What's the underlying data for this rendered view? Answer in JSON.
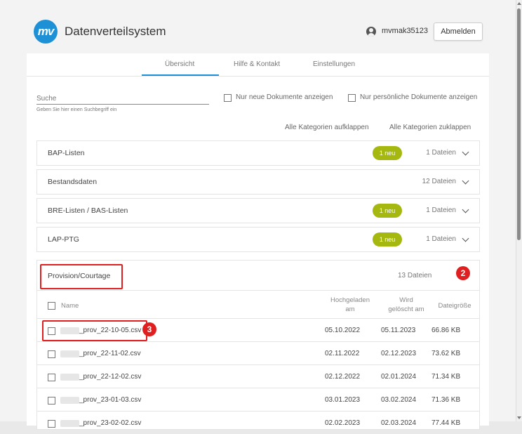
{
  "app": {
    "logo_text": "mv",
    "title": "Datenverteilsystem"
  },
  "user": {
    "name": "mvmak35123",
    "logout_label": "Abmelden"
  },
  "tabs": [
    {
      "label": "Übersicht",
      "active": true
    },
    {
      "label": "Hilfe & Kontakt",
      "active": false
    },
    {
      "label": "Einstellungen",
      "active": false
    }
  ],
  "search": {
    "placeholder": "Suche",
    "hint": "Geben Sie hier einen Suchbegriff ein"
  },
  "filters": {
    "new_only_label": "Nur neue Dokumente anzeigen",
    "personal_only_label": "Nur persönliche Dokumente anzeigen"
  },
  "actions": {
    "expand_all": "Alle Kategorien aufklappen",
    "collapse_all": "Alle Kategorien zuklappen"
  },
  "categories": [
    {
      "label": "BAP-Listen",
      "badge": "1 neu",
      "count": "1 Dateien"
    },
    {
      "label": "Bestandsdaten",
      "badge": "",
      "count": "12 Dateien"
    },
    {
      "label": "BRE-Listen / BAS-Listen",
      "badge": "1 neu",
      "count": "1 Dateien"
    },
    {
      "label": "LAP-PTG",
      "badge": "1 neu",
      "count": "1 Dateien"
    }
  ],
  "provision": {
    "label": "Provision/Courtage",
    "count": "13 Dateien",
    "marker": "2",
    "file_marker": "3",
    "columns": {
      "name": "Name",
      "uploaded_line1": "Hochgeladen",
      "uploaded_line2": "am",
      "deleted_line1": "Wird",
      "deleted_line2": "gelöscht am",
      "size": "Dateigröße"
    },
    "files": [
      {
        "name": "_prov_22-10-05.csv",
        "uploaded": "05.10.2022",
        "deleted": "05.11.2023",
        "size": "66.86 KB"
      },
      {
        "name": "_prov_22-11-02.csv",
        "uploaded": "02.11.2022",
        "deleted": "02.12.2023",
        "size": "73.62 KB"
      },
      {
        "name": "_prov_22-12-02.csv",
        "uploaded": "02.12.2022",
        "deleted": "02.01.2024",
        "size": "71.34 KB"
      },
      {
        "name": "_prov_23-01-03.csv",
        "uploaded": "03.01.2023",
        "deleted": "03.02.2024",
        "size": "71.36 KB"
      },
      {
        "name": "_prov_23-02-02.csv",
        "uploaded": "02.02.2023",
        "deleted": "02.03.2024",
        "size": "77.44 KB"
      }
    ]
  },
  "colors": {
    "accent": "#1e90d6",
    "badge": "#a5b80f",
    "highlight": "#e02020"
  }
}
